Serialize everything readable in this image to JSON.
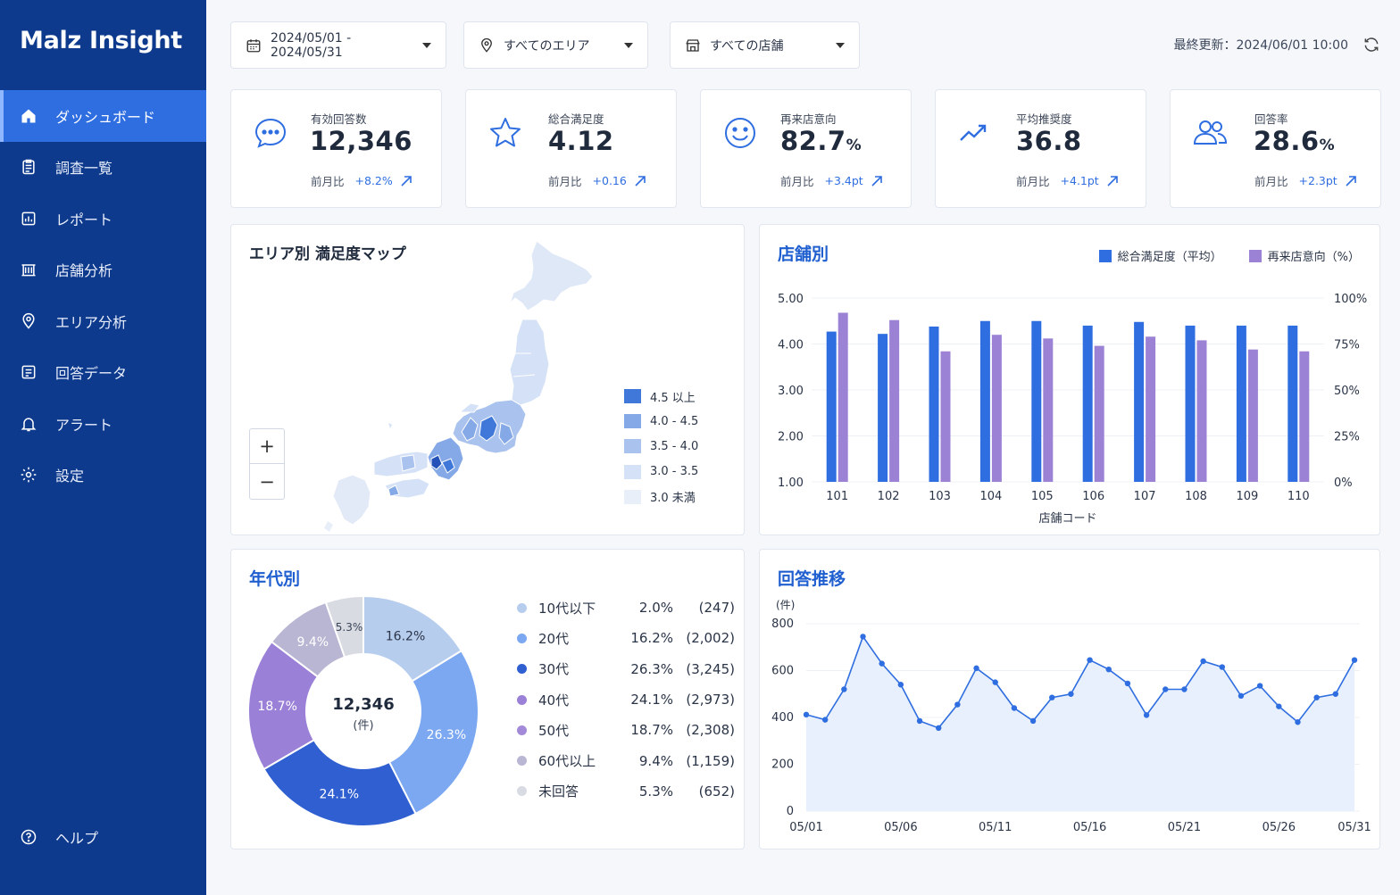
{
  "app": {
    "name": "Malz Insight"
  },
  "sidebar": {
    "items": [
      {
        "label": "ダッシュボード",
        "icon": "home-icon",
        "active": true
      },
      {
        "label": "調査一覧",
        "icon": "clipboard-icon",
        "active": false
      },
      {
        "label": "レポート",
        "icon": "report-icon",
        "active": false
      },
      {
        "label": "店舗分析",
        "icon": "store-icon",
        "active": false
      },
      {
        "label": "エリア分析",
        "icon": "map-pin-icon",
        "active": false
      },
      {
        "label": "回答データ",
        "icon": "data-list-icon",
        "active": false
      },
      {
        "label": "アラート",
        "icon": "bell-icon",
        "active": false
      },
      {
        "label": "設定",
        "icon": "gear-icon",
        "active": false
      }
    ],
    "help": "ヘルプ"
  },
  "filters": {
    "date_range": "2024/05/01 - 2024/05/31",
    "area": "すべてのエリア",
    "store": "すべての店舗",
    "last_updated": "最終更新：2024/06/01 10:00"
  },
  "kpis": [
    {
      "label": "有効回答数",
      "value": "12,346",
      "unit": "",
      "compare_label": "前月比",
      "delta": "+8.2%",
      "icon": "chat-bubble-icon"
    },
    {
      "label": "総合満足度",
      "value": "4.12",
      "unit": "",
      "compare_label": "前月比",
      "delta": "+0.16",
      "icon": "star-icon"
    },
    {
      "label": "再来店意向",
      "value": "82.7",
      "unit": "%",
      "compare_label": "前月比",
      "delta": "+3.4pt",
      "icon": "smile-icon"
    },
    {
      "label": "平均推奨度",
      "value": "36.8",
      "unit": "",
      "compare_label": "前月比",
      "delta": "+4.1pt",
      "icon": "trend-up-icon"
    },
    {
      "label": "回答率",
      "value": "28.6",
      "unit": "%",
      "compare_label": "前月比",
      "delta": "+2.3pt",
      "icon": "users-icon"
    }
  ],
  "map_panel": {
    "title": "エリア別 満足度マップ",
    "zoom_in": "+",
    "zoom_out": "−",
    "legend": [
      {
        "label": "4.5 以上",
        "color": "#3f78d8"
      },
      {
        "label": "4.0 - 4.5",
        "color": "#85a9e6"
      },
      {
        "label": "3.5 - 4.0",
        "color": "#a9c2ee"
      },
      {
        "label": "3.0 - 3.5",
        "color": "#d4e1f6"
      },
      {
        "label": "3.0 未満",
        "color": "#e9eff9"
      }
    ]
  },
  "store_panel": {
    "title": "店舗別",
    "chart_data": {
      "type": "bar",
      "categories": [
        "101",
        "102",
        "103",
        "104",
        "105",
        "106",
        "107",
        "108",
        "109",
        "110"
      ],
      "series": [
        {
          "name": "総合満足度（平均）",
          "axis": "left",
          "color": "#2f6ee0",
          "values": [
            4.27,
            4.22,
            4.38,
            4.5,
            4.5,
            4.4,
            4.48,
            4.4,
            4.4,
            4.4
          ]
        },
        {
          "name": "再来店意向（%）",
          "axis": "right",
          "color": "#9b82d4",
          "values": [
            92,
            88,
            71,
            80,
            78,
            74,
            79,
            77,
            72,
            71
          ]
        }
      ],
      "xlabel": "店舗コード",
      "ylim_left": [
        1,
        5
      ],
      "yticks_left": [
        "1.00",
        "2.00",
        "3.00",
        "4.00",
        "5.00"
      ],
      "ylim_right": [
        0,
        100
      ],
      "yticks_right": [
        "0%",
        "25%",
        "50%",
        "75%",
        "100%"
      ],
      "grid": true
    }
  },
  "age_panel": {
    "title": "年代別",
    "total": "12,346",
    "total_unit": "(件)",
    "chart_data": {
      "type": "pie",
      "slices": [
        {
          "label": "10代以下",
          "pct": 2.0,
          "pct_text": "2.0%",
          "count": "(247)",
          "color": "#b7cdee",
          "show_label": false
        },
        {
          "label": "20代",
          "pct": 16.2,
          "pct_text": "16.2%",
          "count": "(2,002)",
          "color": "#7ca8f2",
          "show_label": true
        },
        {
          "label": "30代",
          "pct": 26.3,
          "pct_text": "26.3%",
          "count": "(3,245)",
          "color": "#2f5fd0",
          "show_label": true
        },
        {
          "label": "40代",
          "pct": 24.1,
          "pct_text": "24.1%",
          "count": "(2,973)",
          "color": "#9a80d6",
          "show_label": true
        },
        {
          "label": "50代",
          "pct": 18.7,
          "pct_text": "18.7%",
          "count": "(2,308)",
          "color": "#a28ad8",
          "show_label": true
        },
        {
          "label": "60代以上",
          "pct": 9.4,
          "pct_text": "9.4%",
          "count": "(1,159)",
          "color": "#b9b6d3",
          "show_label": true
        },
        {
          "label": "未回答",
          "pct": 5.3,
          "pct_text": "5.3%",
          "count": "(652)",
          "color": "#d9dbe3",
          "show_label": true
        }
      ],
      "ring_sequence": [
        {
          "value": 16.2,
          "label": "16.2%",
          "color": "#b7cdee",
          "text_color": "#2a3447"
        },
        {
          "value": 26.3,
          "label": "26.3%",
          "color": "#7ca8f2",
          "text_color": "#ffffff"
        },
        {
          "value": 24.1,
          "label": "24.1%",
          "color": "#2f5fd0",
          "text_color": "#ffffff"
        },
        {
          "value": 18.7,
          "label": "18.7%",
          "color": "#9a80d6",
          "text_color": "#ffffff"
        },
        {
          "value": 9.4,
          "label": "9.4%",
          "color": "#b9b6d3",
          "text_color": "#ffffff"
        },
        {
          "value": 5.3,
          "label": "5.3%",
          "color": "#d9dbe3",
          "text_color": "#3a4456"
        }
      ]
    }
  },
  "trend_panel": {
    "title": "回答推移",
    "chart_data": {
      "type": "area",
      "unit_label": "(件)",
      "ylim": [
        0,
        800
      ],
      "yticks": [
        "0",
        "200",
        "400",
        "600",
        "800"
      ],
      "xtick_labels": [
        "05/01",
        "05/06",
        "05/11",
        "05/16",
        "05/21",
        "05/26",
        "05/31"
      ],
      "xtick_index": [
        0,
        5,
        10,
        15,
        20,
        25,
        30
      ],
      "values": [
        412,
        390,
        520,
        745,
        630,
        540,
        385,
        355,
        455,
        610,
        550,
        440,
        385,
        485,
        500,
        645,
        605,
        545,
        410,
        520,
        520,
        640,
        615,
        492,
        535,
        447,
        380,
        485,
        500,
        645
      ],
      "color": "#2f6ee0",
      "fill": "#e8f0fd",
      "grid": true
    }
  }
}
